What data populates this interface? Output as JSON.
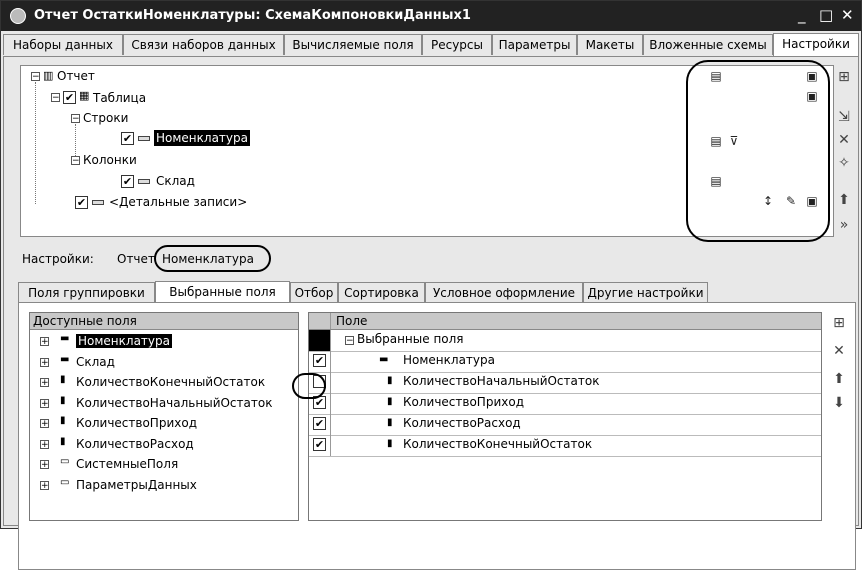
{
  "window": {
    "title": "Отчет ОстаткиНоменклатуры: СхемаКомпоновкиДанных1",
    "minimize": "_",
    "maximize": "□",
    "close": "✕"
  },
  "top_tabs": [
    "Наборы данных",
    "Связи наборов данных",
    "Вычисляемые поля",
    "Ресурсы",
    "Параметры",
    "Макеты",
    "Вложенные схемы",
    "Настройки"
  ],
  "active_top_tab": "Настройки",
  "structure_tree": {
    "report": "Отчет",
    "table": "Таблица",
    "rows": "Строки",
    "rows_item": "Номенклатура",
    "columns": "Колонки",
    "columns_item": "Склад",
    "detail": "<Детальные записи>"
  },
  "settings_path": {
    "label": "Настройки:",
    "root": "Отчет",
    "current": "Номенклатура"
  },
  "inner_tabs": [
    "Поля группировки",
    "Выбранные поля",
    "Отбор",
    "Сортировка",
    "Условное оформление",
    "Другие настройки"
  ],
  "active_inner_tab": "Выбранные поля",
  "available_fields": {
    "header": "Доступные поля",
    "items": [
      "Номенклатура",
      "Склад",
      "КоличествоКонечныйОстаток",
      "КоличествоНачальныйОстаток",
      "КоличествоПриход",
      "КоличествоРасход",
      "СистемныеПоля",
      "ПараметрыДанных"
    ]
  },
  "selected_fields": {
    "header": "Поле",
    "group": "Выбранные поля",
    "rows": [
      {
        "name": "Номенклатура",
        "checked": true
      },
      {
        "name": "КоличествоНачальныйОстаток",
        "checked": false
      },
      {
        "name": "КоличествоПриход",
        "checked": true
      },
      {
        "name": "КоличествоРасход",
        "checked": true
      },
      {
        "name": "КоличествоКонечныйОстаток",
        "checked": true
      }
    ]
  },
  "check_mark": "✔",
  "colors": {
    "titlebar": "#222222",
    "selection": "#000000",
    "header_bg": "#c8c8c8"
  }
}
